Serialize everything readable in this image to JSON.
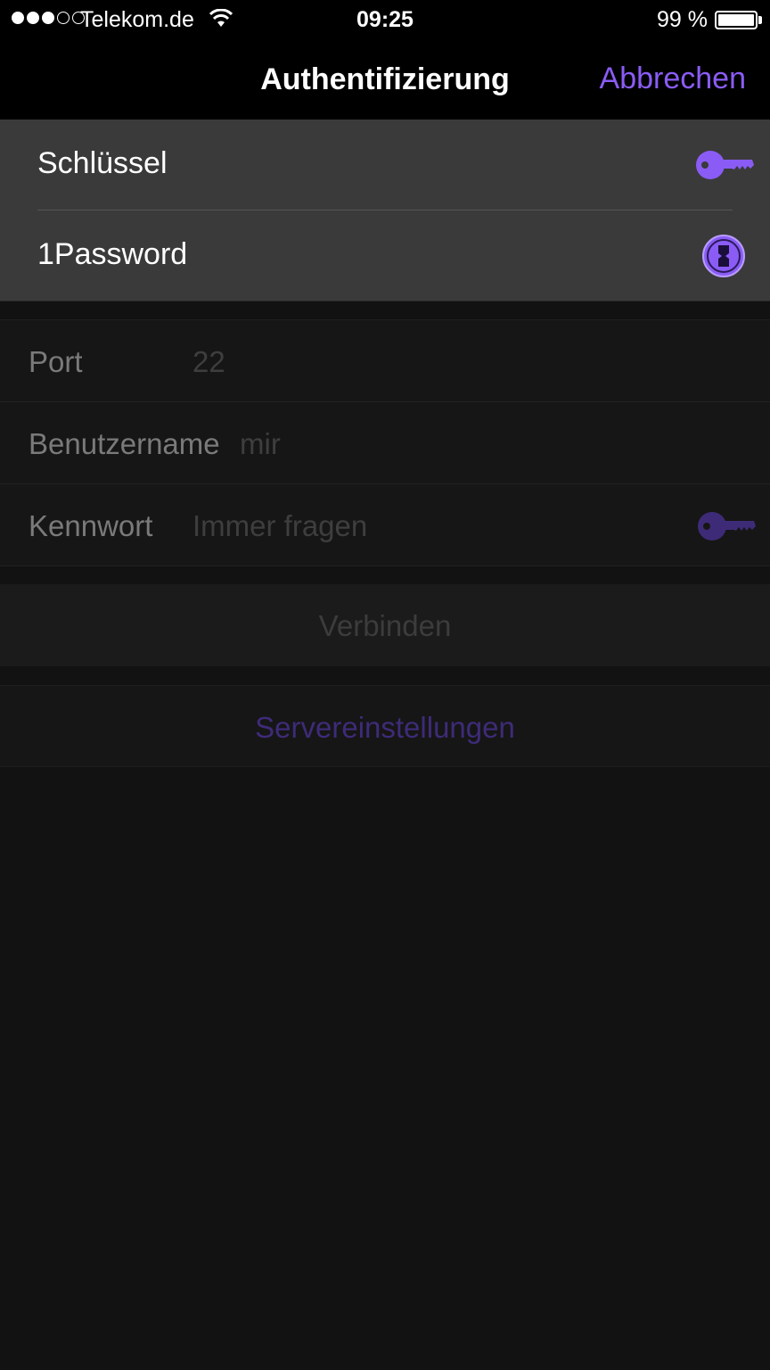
{
  "status_bar": {
    "carrier": "Telekom.de",
    "time": "09:25",
    "battery": "99 %",
    "battery_level": 0.99
  },
  "nav": {
    "title": "Authentifizierung",
    "cancel_label": "Abbrechen"
  },
  "auth_menu": {
    "items": [
      {
        "label": "Schlüssel",
        "icon": "key-icon"
      },
      {
        "label": "1Password",
        "icon": "1password-icon"
      }
    ]
  },
  "form": {
    "port": {
      "label": "Port",
      "value": "22"
    },
    "username": {
      "label": "Benutzername",
      "value": "mir"
    },
    "password": {
      "label": "Kennwort",
      "value": "Immer fragen",
      "icon": "key-icon"
    }
  },
  "actions": {
    "connect_label": "Verbinden",
    "server_settings_label": "Servereinstellungen"
  },
  "colors": {
    "accent": "#8a5cf5",
    "background": "#121212",
    "menu_background": "#3a3a3a"
  }
}
